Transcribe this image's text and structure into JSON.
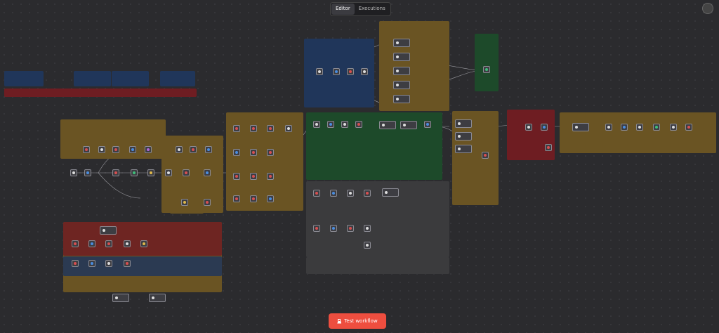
{
  "header": {
    "tabs": [
      {
        "label": "Editor",
        "active": true
      },
      {
        "label": "Executions",
        "active": false
      }
    ]
  },
  "footer": {
    "test_button_label": "Test workflow"
  },
  "colors": {
    "canvas": "#2b2b2e",
    "note_brown": "#6a5423",
    "note_blue": "#20365a",
    "note_red": "#6e1d22",
    "note_green": "#1d4a2a",
    "test_button": "#ee4e3f"
  },
  "icons": {
    "test_button": "flask-icon",
    "user": "user-avatar-icon"
  }
}
